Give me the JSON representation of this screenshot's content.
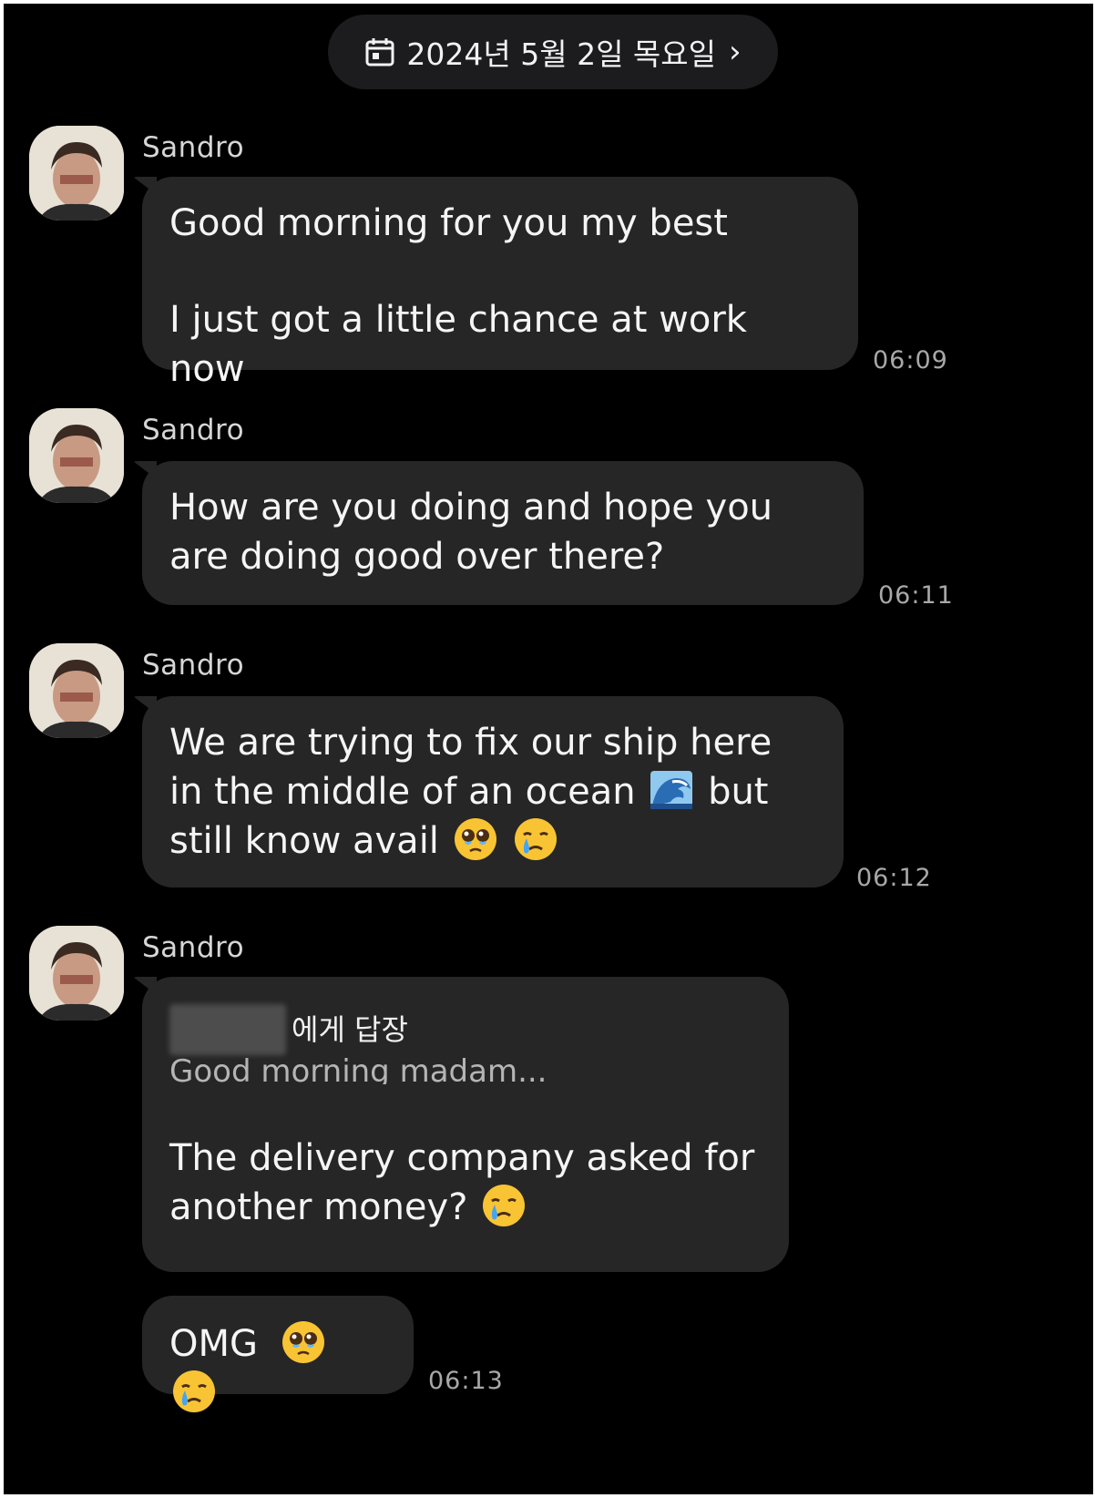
{
  "date_header": {
    "label": "2024년 5월 2일 목요일",
    "icon": "calendar-icon",
    "chevron": "›"
  },
  "messages": [
    {
      "sender": "Sandro",
      "lines": [
        "Good morning for you my best",
        "I just got a little chance at work now"
      ],
      "time": "06:09"
    },
    {
      "sender": "Sandro",
      "text": "How are you doing and hope you are doing good over there?",
      "time": "06:11"
    },
    {
      "sender": "Sandro",
      "text_part1": "We are trying to fix our ship here in the middle of an ocean",
      "text_part2": "but still know avail",
      "emojis": [
        "water-wave-emoji",
        "pleading-face-emoji",
        "crying-face-emoji"
      ],
      "time": "06:12"
    },
    {
      "sender": "Sandro",
      "reply": {
        "label": "에게 답장",
        "quote": "Good morning madam..."
      },
      "text": "The delivery company asked for another money?",
      "emojis": [
        "crying-face-emoji"
      ]
    },
    {
      "text": "OMG",
      "emojis": [
        "pleading-face-emoji",
        "crying-face-emoji"
      ],
      "time": "06:13"
    }
  ],
  "colors": {
    "background": "#000000",
    "bubble": "#262626",
    "text": "#f5f5f5",
    "timestamp": "#a8a8a8",
    "date_pill": "#1c1c1e"
  }
}
